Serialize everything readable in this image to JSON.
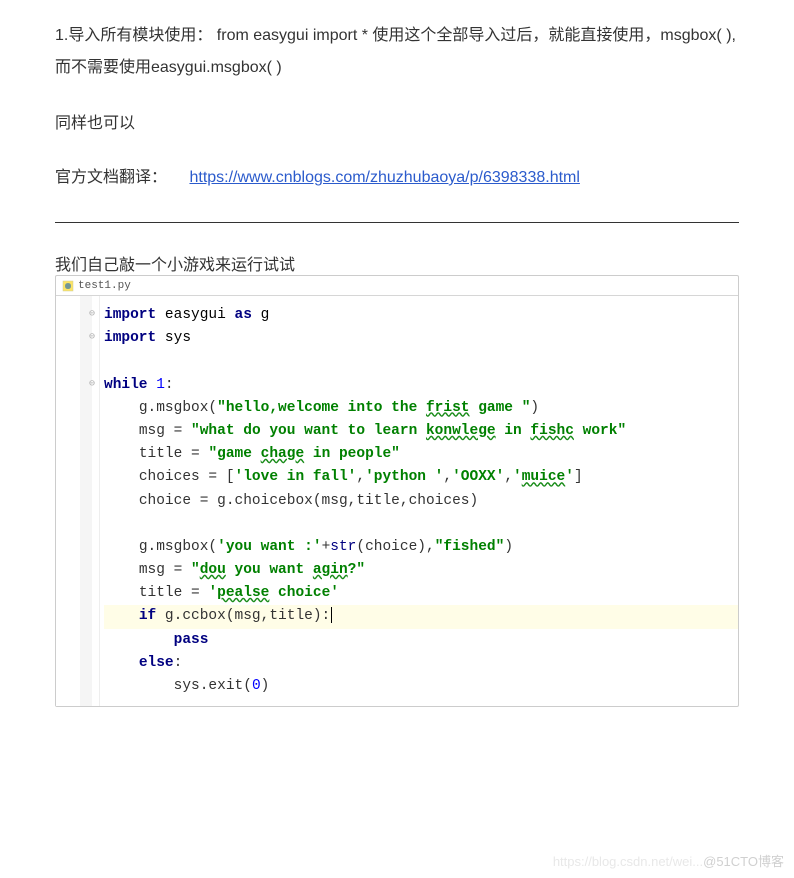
{
  "paragraph1": "1.导入所有模块使用：     from easygui import *     使用这个全部导入过后，就能直接使用，msgbox( ),而不需要使用easygui.msgbox( )",
  "paragraph2": "同样也可以",
  "translation": {
    "label": "官方文档翻译：",
    "url": "https://www.cnblogs.com/zhuzhubaoya/p/6398338.html"
  },
  "subtitle": "我们自己敲一个小游戏来运行试试",
  "ide": {
    "filename": "test1.py"
  },
  "code": {
    "line1": {
      "kw1": "import ",
      "ident1": "easygui ",
      "kw2": "as ",
      "ident2": "g"
    },
    "line2": {
      "kw1": "import ",
      "ident1": "sys"
    },
    "line3": "",
    "line4": {
      "kw1": "while ",
      "num": "1",
      "colon": ":"
    },
    "line5": {
      "indent": "    ",
      "obj": "g.msgbox(",
      "str1": "\"hello,welcome into the ",
      "typo1": "frist",
      "str2": " game \"",
      "close": ")"
    },
    "line6": {
      "indent": "    ",
      "lhs": "msg = ",
      "str1": "\"what do you want to learn ",
      "typo1": "konwlege",
      "str2": " in ",
      "typo2": "fishc",
      "str3": " work\""
    },
    "line7": {
      "indent": "    ",
      "lhs": "title = ",
      "str1": "\"game ",
      "typo1": "chage",
      "str2": " in people\""
    },
    "line8": {
      "indent": "    ",
      "lhs": "choices = [",
      "str1": "'love in fall'",
      "c1": ",",
      "str2": "'python '",
      "c2": ",",
      "str3": "'OOXX'",
      "c3": ",",
      "str4": "'",
      "typo1": "muice",
      "str5": "'",
      "close": "]"
    },
    "line9": {
      "indent": "    ",
      "lhs": "choice = g.choicebox(msg",
      "c1": ",",
      "a2": "title",
      "c2": ",",
      "a3": "choices)"
    },
    "line10": "",
    "line11": {
      "indent": "    ",
      "obj": "g.msgbox(",
      "str1": "'you want :'",
      "plus": "+",
      "builtin": "str",
      "open": "(choice)",
      "c1": ",",
      "str2": "\"fished\"",
      "close": ")"
    },
    "line12": {
      "indent": "    ",
      "lhs": "msg = ",
      "str1": "\"",
      "typo1": "dou",
      "str2": " you want ",
      "typo2": "agin",
      "str3": "?\""
    },
    "line13": {
      "indent": "    ",
      "lhs": "title = ",
      "str1": "'",
      "typo1": "pealse",
      "str2": " choice'"
    },
    "line14": {
      "indent": "    ",
      "kw1": "if ",
      "call": "g.ccbox(msg",
      "c1": ",",
      "a2": "title):"
    },
    "line15": {
      "indent": "        ",
      "kw1": "pass"
    },
    "line16": {
      "indent": "    ",
      "kw1": "else",
      "colon": ":"
    },
    "line17": {
      "indent": "        ",
      "call": "sys.exit(",
      "num": "0",
      "close": ")"
    }
  },
  "watermark": {
    "faint": "https://blog.csdn.net/wei...",
    "bold": "@51CTO博客"
  }
}
